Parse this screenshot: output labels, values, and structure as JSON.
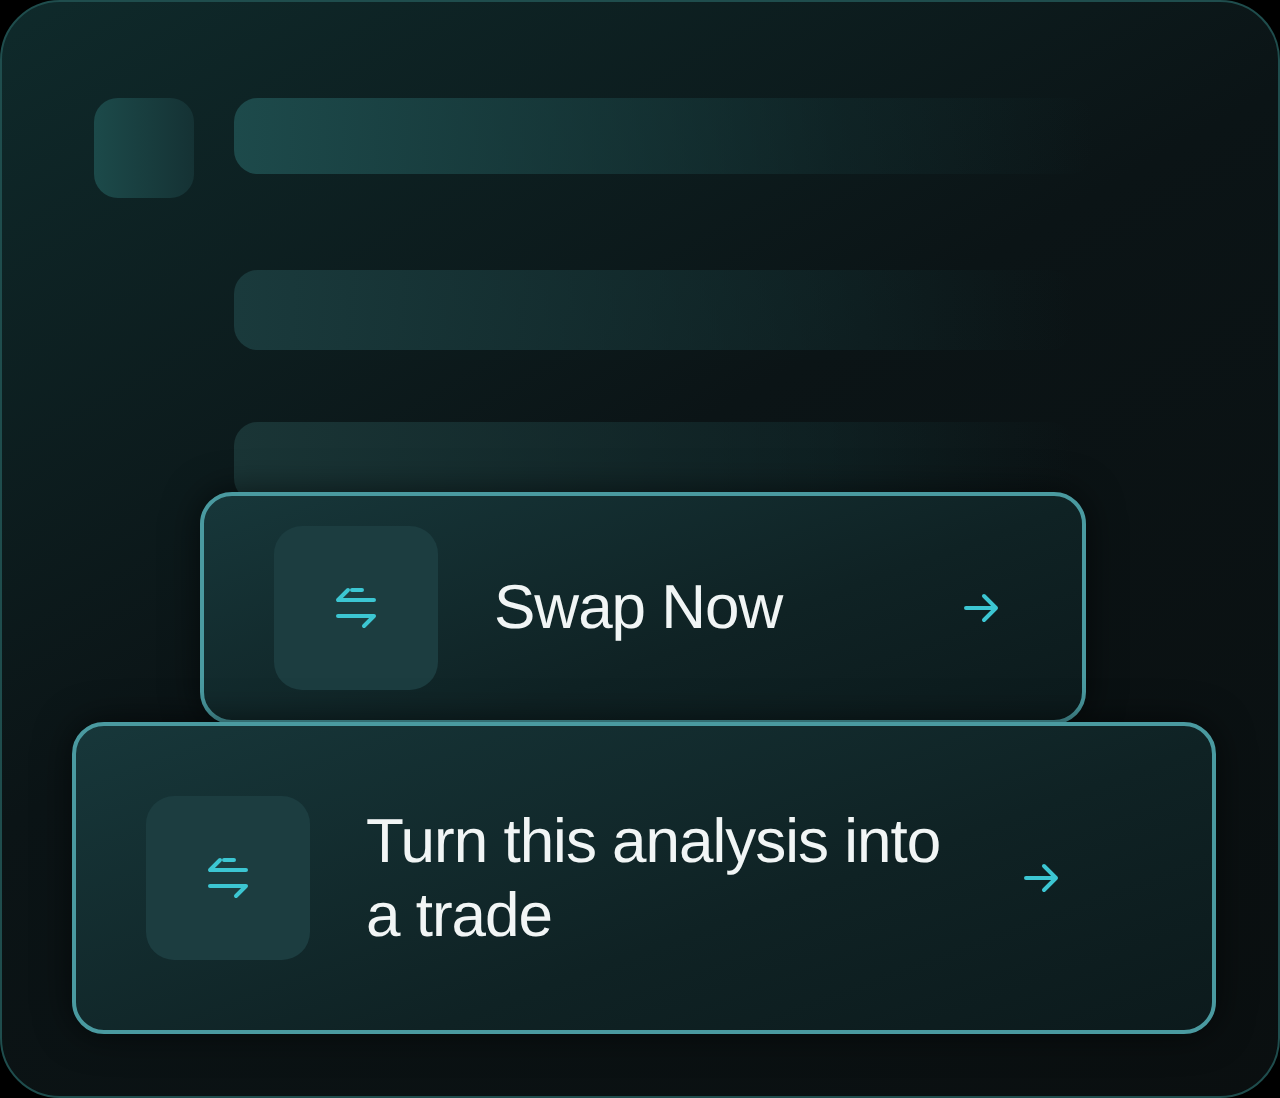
{
  "cards": [
    {
      "label": "Swap Now"
    },
    {
      "label": "Turn this analysis into a trade"
    }
  ]
}
